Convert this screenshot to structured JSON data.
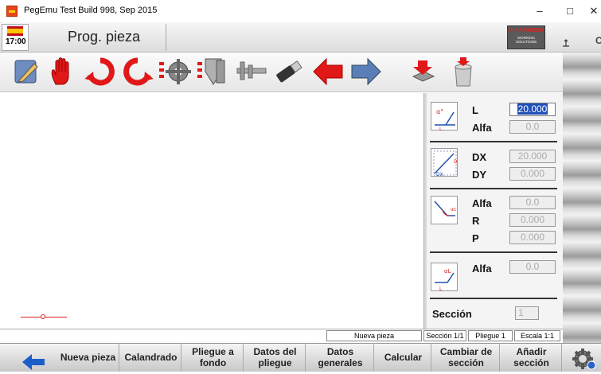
{
  "window": {
    "title": "PegEmu Test Build 998, Sep 2015",
    "controls": [
      "–",
      "□",
      "✕"
    ]
  },
  "header": {
    "time": "17:00",
    "title": "Prog. pieza",
    "logo_brand": "N NARGESA",
    "logo_sub": "WORKING SOLUTIONS",
    "edge_glyph": "C"
  },
  "toolbar": {
    "icons": [
      "edit-icon",
      "hand-stop-icon",
      "rotate-left-icon",
      "rotate-right-icon",
      "gear-list-icon",
      "bending-list-icon",
      "caliper-icon",
      "usb-icon",
      "arrow-left-icon",
      "arrow-right-icon",
      "import-icon",
      "trash-icon"
    ]
  },
  "panel": {
    "sections": [
      {
        "icon": "length-angle-diagram-icon",
        "rows": [
          {
            "label": "L",
            "value": "20.000",
            "active": true
          },
          {
            "label": "Alfa",
            "value": "0.0"
          }
        ]
      },
      {
        "icon": "dx-dy-diagram-icon",
        "rows": [
          {
            "label": "DX",
            "value": "20.000"
          },
          {
            "label": "DY",
            "value": "0.000"
          }
        ]
      },
      {
        "icon": "radius-diagram-icon",
        "rows": [
          {
            "label": "Alfa",
            "value": "0.0"
          },
          {
            "label": "R",
            "value": "0.000"
          },
          {
            "label": "P",
            "value": "0.000"
          }
        ]
      },
      {
        "icon": "alfa-diagram-icon",
        "rows": [
          {
            "label": "Alfa",
            "value": "0.0"
          }
        ]
      }
    ],
    "section_label": "Sección",
    "section_value": "1"
  },
  "status": {
    "piece": "Nueva pieza",
    "section": "Sección 1/1",
    "bend": "Pliegue 1",
    "scale": "Escala 1:1"
  },
  "bottom": {
    "buttons": [
      {
        "name": "nueva-pieza-button",
        "label": "Nueva pieza"
      },
      {
        "name": "calandrado-button",
        "label": "Calandrado"
      },
      {
        "name": "pliegue-a-fondo-button",
        "label": "Pliegue a fondo"
      },
      {
        "name": "datos-del-pliegue-button",
        "label": "Datos del pliegue"
      },
      {
        "name": "datos-generales-button",
        "label": "Datos generales"
      },
      {
        "name": "calcular-button",
        "label": "Calcular"
      },
      {
        "name": "cambiar-de-seccion-button",
        "label": "Cambiar de sección"
      },
      {
        "name": "anadir-seccion-button",
        "label": "Añadir sección"
      }
    ]
  },
  "colors": {
    "accent_red": "#e02020",
    "back_arrow_blue": "#1a5fc8",
    "active_field": "#1f4fb8"
  }
}
